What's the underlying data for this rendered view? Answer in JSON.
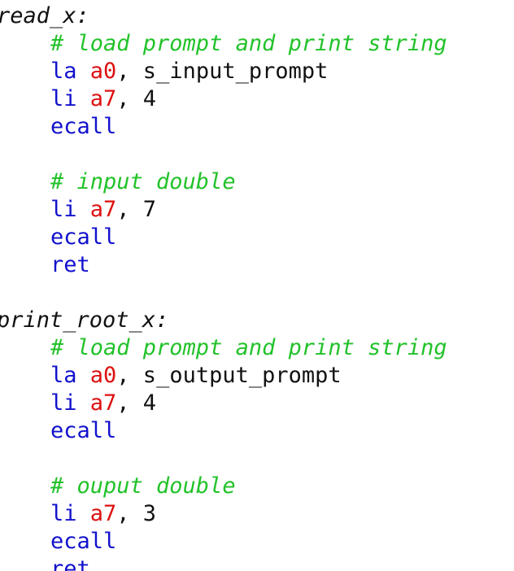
{
  "editor": {
    "blocks": [
      {
        "label": "read_x:",
        "lines": [
          {
            "kind": "comment",
            "text": "# load prompt and print string"
          },
          {
            "kind": "instr",
            "op": "la",
            "reg": "a0",
            "rest": ", s_input_prompt"
          },
          {
            "kind": "instr",
            "op": "li",
            "reg": "a7",
            "rest": ", 4"
          },
          {
            "kind": "instr",
            "op": "ecall"
          },
          {
            "kind": "blank"
          },
          {
            "kind": "comment",
            "text": "# input double"
          },
          {
            "kind": "instr",
            "op": "li",
            "reg": "a7",
            "rest": ", 7"
          },
          {
            "kind": "instr",
            "op": "ecall"
          },
          {
            "kind": "instr",
            "op": "ret"
          }
        ]
      },
      {
        "label": "print_root_x:",
        "lines": [
          {
            "kind": "comment",
            "text": "# load prompt and print string"
          },
          {
            "kind": "instr",
            "op": "la",
            "reg": "a0",
            "rest": ", s_output_prompt"
          },
          {
            "kind": "instr",
            "op": "li",
            "reg": "a7",
            "rest": ", 4"
          },
          {
            "kind": "instr",
            "op": "ecall"
          },
          {
            "kind": "blank"
          },
          {
            "kind": "comment",
            "text": "# ouput double"
          },
          {
            "kind": "instr",
            "op": "li",
            "reg": "a7",
            "rest": ", 3"
          },
          {
            "kind": "instr",
            "op": "ecall"
          },
          {
            "kind": "instr",
            "op": "ret"
          }
        ]
      }
    ]
  }
}
